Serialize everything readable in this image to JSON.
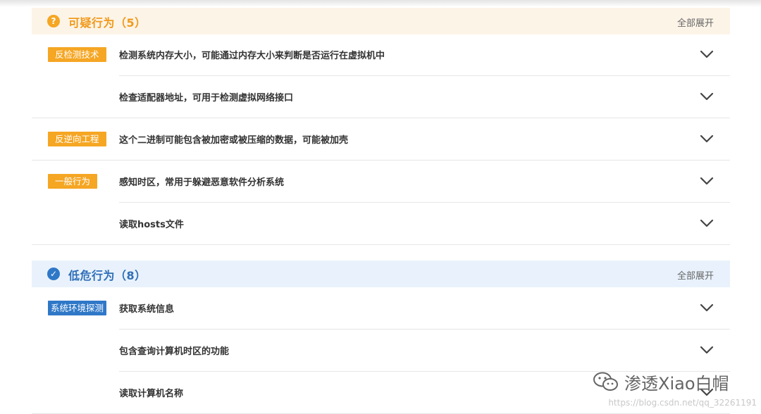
{
  "sections": {
    "suspicious": {
      "icon": "question-icon",
      "icon_glyph": "?",
      "title": "可疑行为（5）",
      "expand_all": "全部展开",
      "accent": "#f5a623",
      "rows": [
        {
          "tag": "反检测技术",
          "text": "检测系统内存大小，可能通过内存大小来判断是否运行在虚拟机中"
        },
        {
          "tag": "",
          "text": "检查适配器地址，可用于检测虚拟网络接口"
        },
        {
          "tag": "反逆向工程",
          "text": "这个二进制可能包含被加密或被压缩的数据，可能被加壳"
        },
        {
          "tag": "一般行为",
          "text": "感知时区，常用于躲避恶意软件分析系统"
        },
        {
          "tag": "",
          "text": "读取hosts文件"
        }
      ]
    },
    "lowrisk": {
      "icon": "check-circle-icon",
      "icon_glyph": "✓",
      "title": "低危行为（8）",
      "expand_all": "全部展开",
      "accent": "#2f78c8",
      "rows": [
        {
          "tag": "系统环境探测",
          "text": "获取系统信息"
        },
        {
          "tag": "",
          "text": "包含查询计算机时区的功能"
        },
        {
          "tag": "",
          "text": "读取计算机名称"
        }
      ]
    }
  },
  "watermark": {
    "icon": "wechat-icon",
    "text": "渗透Xiao白帽",
    "url": "https://blog.csdn.net/qq_32261191"
  }
}
